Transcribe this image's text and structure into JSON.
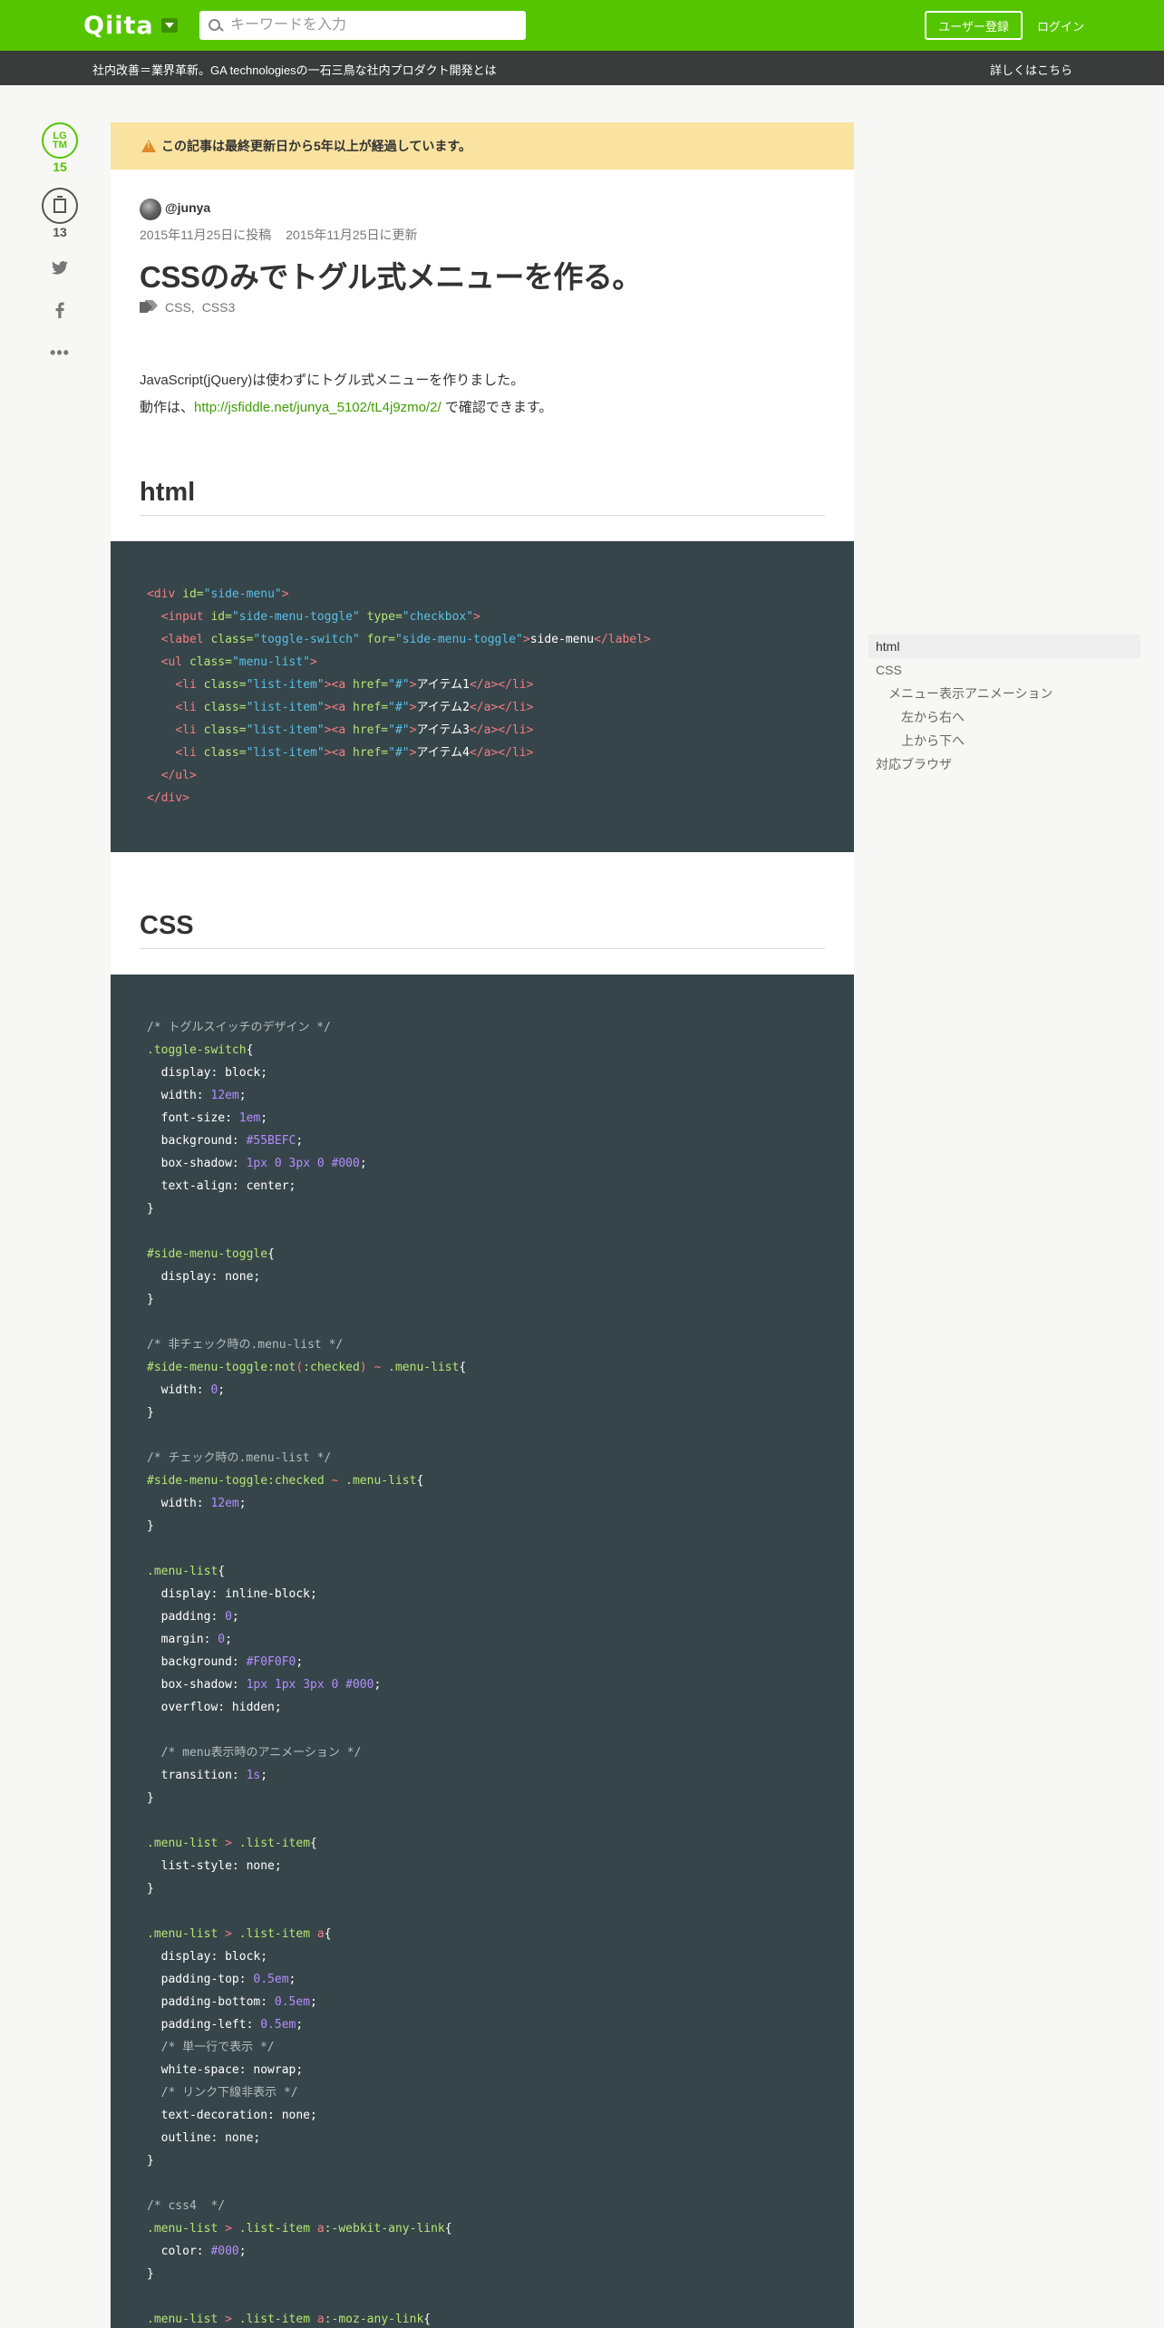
{
  "header": {
    "logo": "Qiita",
    "search_placeholder": "キーワードを入力",
    "signup_label": "ユーザー登録",
    "login_label": "ログイン"
  },
  "adbar": {
    "text": "社内改善＝業界革新。GA technologiesの一石三鳥な社内プロダクト開発とは",
    "link": "詳しくはこちら"
  },
  "social": {
    "lgtm_line1": "LG",
    "lgtm_line2": "TM",
    "lgtm_count": "15",
    "stock_count": "13",
    "more": "•••"
  },
  "article": {
    "alert": "この記事は最終更新日から5年以上が経過しています。",
    "author": "@junya",
    "posted": "2015年11月25日に投稿",
    "updated": "2015年11月25日に更新",
    "title": "CSSのみでトグル式メニューを作る。",
    "tags": [
      "CSS",
      "CSS3"
    ],
    "intro_line1": "JavaScript(jQuery)は使わずにトグル式メニューを作りました。",
    "intro_line2_prefix": "動作は、",
    "intro_link": "http://jsfiddle.net/junya_5102/tL4j9zmo/2/",
    "intro_line2_suffix": " で確認できます。",
    "h2_html": "html",
    "h2_css": "CSS"
  },
  "toc": [
    "html",
    "CSS",
    "メニュー表示アニメーション",
    "左から右へ",
    "上から下へ",
    "対応ブラウザ"
  ],
  "colors": {
    "brand": "#55c500",
    "adbar": "#3a3c3c",
    "code_bg": "#364549",
    "alert_bg": "#fae3a0"
  }
}
